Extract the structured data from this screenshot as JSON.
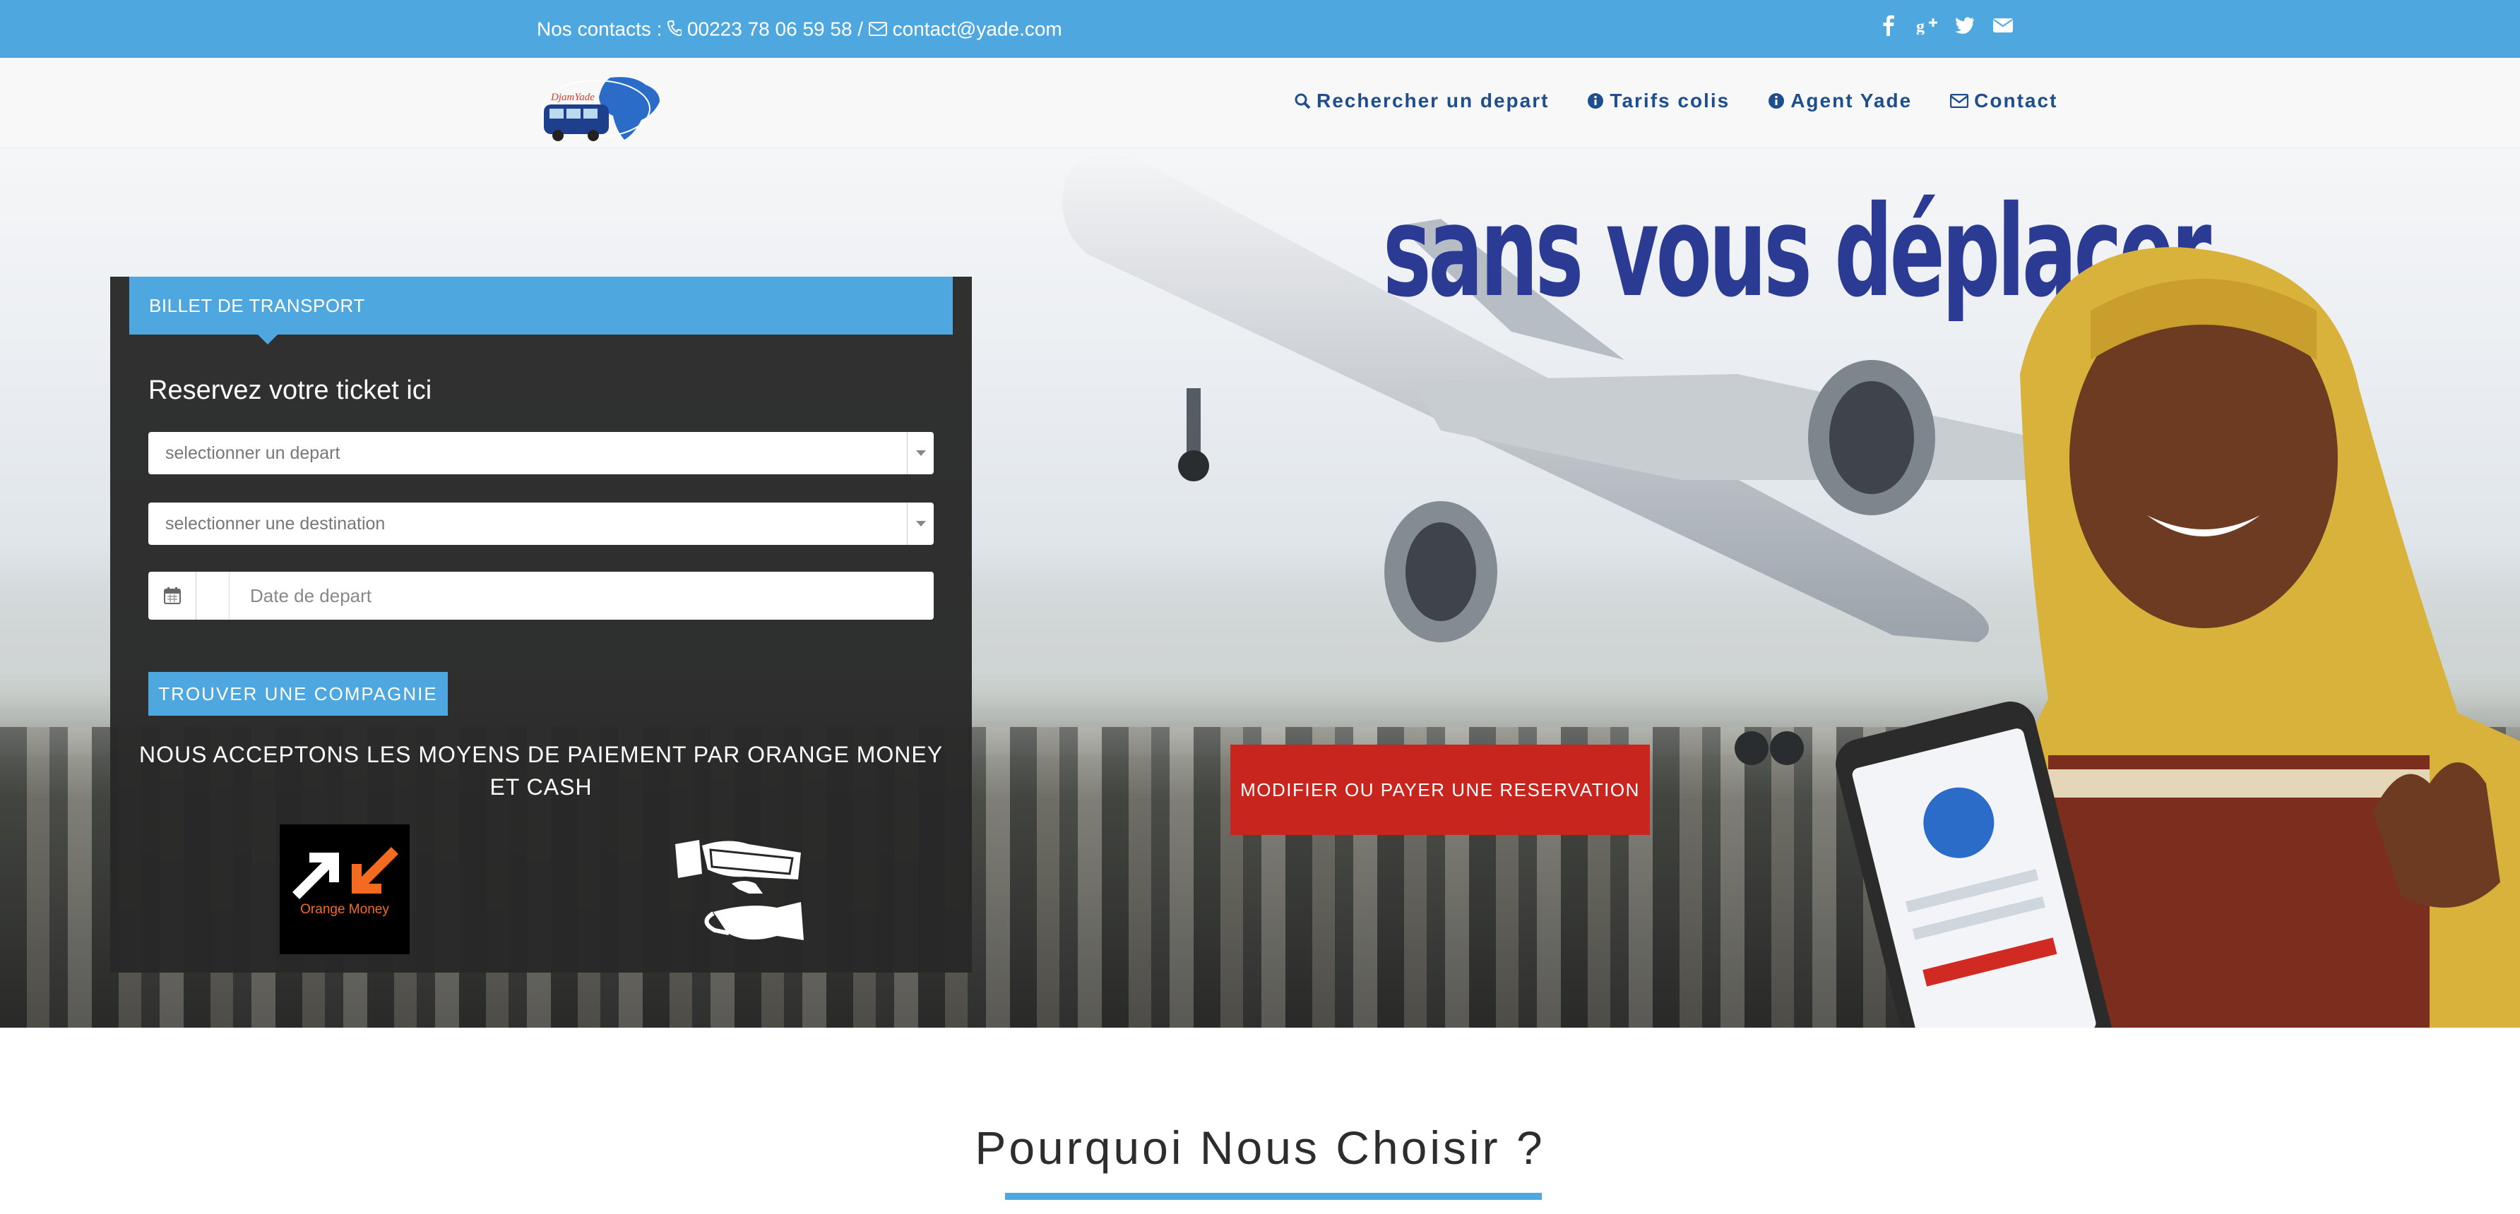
{
  "topbar": {
    "contacts_label": "Nos contacts : ",
    "phone": "00223 78 06 59 58",
    "separator": " / ",
    "email": "contact@yade.com",
    "social_icons": [
      "facebook-icon",
      "google-plus-icon",
      "twitter-icon",
      "envelope-icon"
    ]
  },
  "brand": {
    "logo_text": "DjamYade"
  },
  "nav": {
    "items": [
      {
        "label": "Rechercher un depart",
        "icon": "search-icon"
      },
      {
        "label": "Tarifs colis",
        "icon": "info-circle-icon"
      },
      {
        "label": "Agent Yade",
        "icon": "info-circle-icon"
      },
      {
        "label": "Contact",
        "icon": "envelope-icon"
      }
    ]
  },
  "hero": {
    "slogan": "sans vous déplacer",
    "modify_button": "MODIFIER OU PAYER UNE RESERVATION"
  },
  "booking": {
    "tab_label": "BILLET DE TRANSPORT",
    "form_title": "Reservez votre ticket ici",
    "depart_placeholder": "selectionner un depart",
    "destination_placeholder": "selectionner une destination",
    "date_placeholder": "Date de depart",
    "find_button": "TROUVER UNE COMPAGNIE",
    "payment_note": "NOUS ACCEPTONS LES MOYENS DE PAIEMENT PAR ORANGE MONEY ET CASH",
    "orange_money_label": "Orange Money"
  },
  "section": {
    "title": "Pourquoi Nous Choisir ?"
  },
  "colors": {
    "accent": "#4fa7e0",
    "nav_text": "#1f4e8c",
    "danger": "#c8251e",
    "panel": "#282828",
    "orange": "#f26b21"
  }
}
